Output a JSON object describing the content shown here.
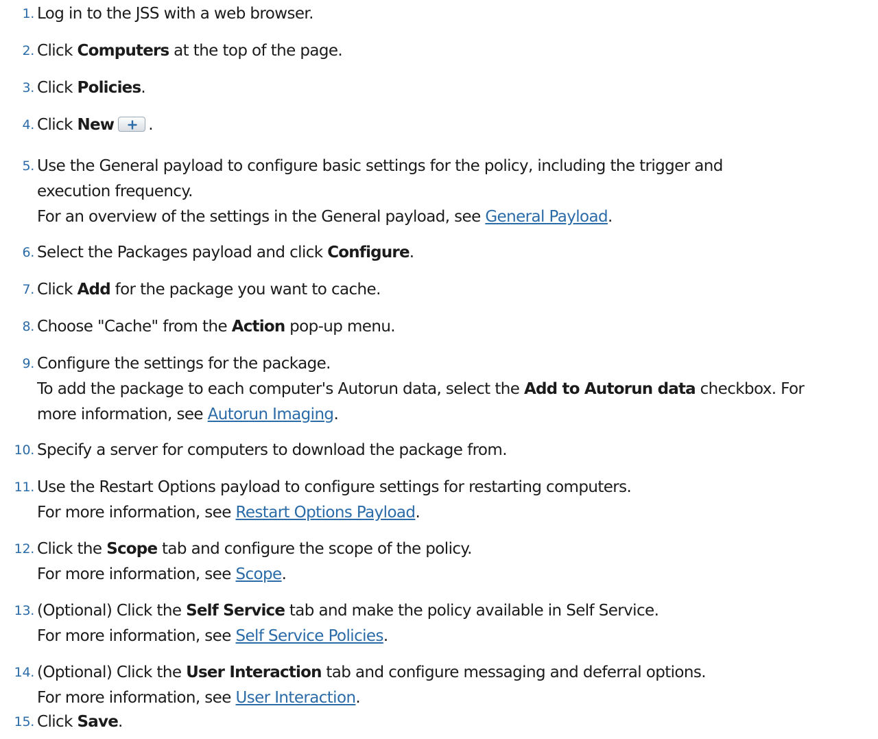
{
  "steps": [
    {
      "num": "1.",
      "lines": [
        {
          "a": "Log in to the JSS with a web browser."
        }
      ]
    },
    {
      "num": "2.",
      "lines": [
        {
          "a": "Click ",
          "b": "Computers",
          "c": " at the top of the page."
        }
      ]
    },
    {
      "num": "3.",
      "lines": [
        {
          "a": "Click ",
          "b": "Policies",
          "c": "."
        }
      ]
    },
    {
      "num": "4.",
      "lines": [
        {
          "a": "Click ",
          "b": "New",
          "c": "."
        }
      ]
    },
    {
      "num": "5.",
      "lines": [
        {
          "a": "Use the General payload to configure basic settings for the policy, including the trigger and"
        },
        {
          "a": "execution frequency."
        },
        {
          "a": "For an overview of the settings in the General payload, see ",
          "link": "General Payload",
          "c": "."
        }
      ]
    },
    {
      "num": "6.",
      "lines": [
        {
          "a": "Select the Packages payload and click ",
          "b": "Configure",
          "c": "."
        }
      ]
    },
    {
      "num": "7.",
      "lines": [
        {
          "a": "Click ",
          "b": "Add",
          "c": " for the package you want to cache."
        }
      ]
    },
    {
      "num": "8.",
      "lines": [
        {
          "a": "Choose \"Cache\" from the ",
          "b": "Action",
          "c": " pop-up menu."
        }
      ]
    },
    {
      "num": "9.",
      "lines": [
        {
          "a": "Configure the settings for the package."
        },
        {
          "a": "To add the package to each computer's Autorun data, select the ",
          "b": "Add to Autorun data",
          "c": " checkbox. For"
        },
        {
          "a": "more information, see ",
          "link": "Autorun Imaging",
          "c": "."
        }
      ]
    },
    {
      "num": "10.",
      "lines": [
        {
          "a": "Specify a server for computers to download the package from."
        }
      ]
    },
    {
      "num": "11.",
      "lines": [
        {
          "a": "Use the Restart Options payload to configure settings for restarting computers."
        },
        {
          "a": "For more information, see ",
          "link": "Restart Options Payload",
          "c": "."
        }
      ]
    },
    {
      "num": "12.",
      "lines": [
        {
          "a": "Click the ",
          "b": "Scope",
          "c": " tab and configure the scope of the policy."
        },
        {
          "a": "For more information, see ",
          "link": "Scope",
          "c": "."
        }
      ]
    },
    {
      "num": "13.",
      "lines": [
        {
          "a": "(Optional) Click the ",
          "b": "Self Service",
          "c": " tab and make the policy available in Self Service."
        },
        {
          "a": "For more information, see ",
          "link": "Self Service Policies",
          "c": "."
        }
      ]
    },
    {
      "num": "14.",
      "lines": [
        {
          "a": "(Optional) Click the ",
          "b": "User Interaction",
          "c": " tab and configure messaging and deferral options."
        },
        {
          "a": "For more information, see ",
          "link": "User Interaction",
          "c": "."
        }
      ]
    },
    {
      "num": "15.",
      "lines": [
        {
          "a": "Click ",
          "b": "Save",
          "c": "."
        }
      ]
    }
  ],
  "icons": {
    "new_button": "plus-icon"
  },
  "colors": {
    "link": "#2a6ba8",
    "step_number": "#2a6ba8",
    "text": "#1b1b1b"
  }
}
